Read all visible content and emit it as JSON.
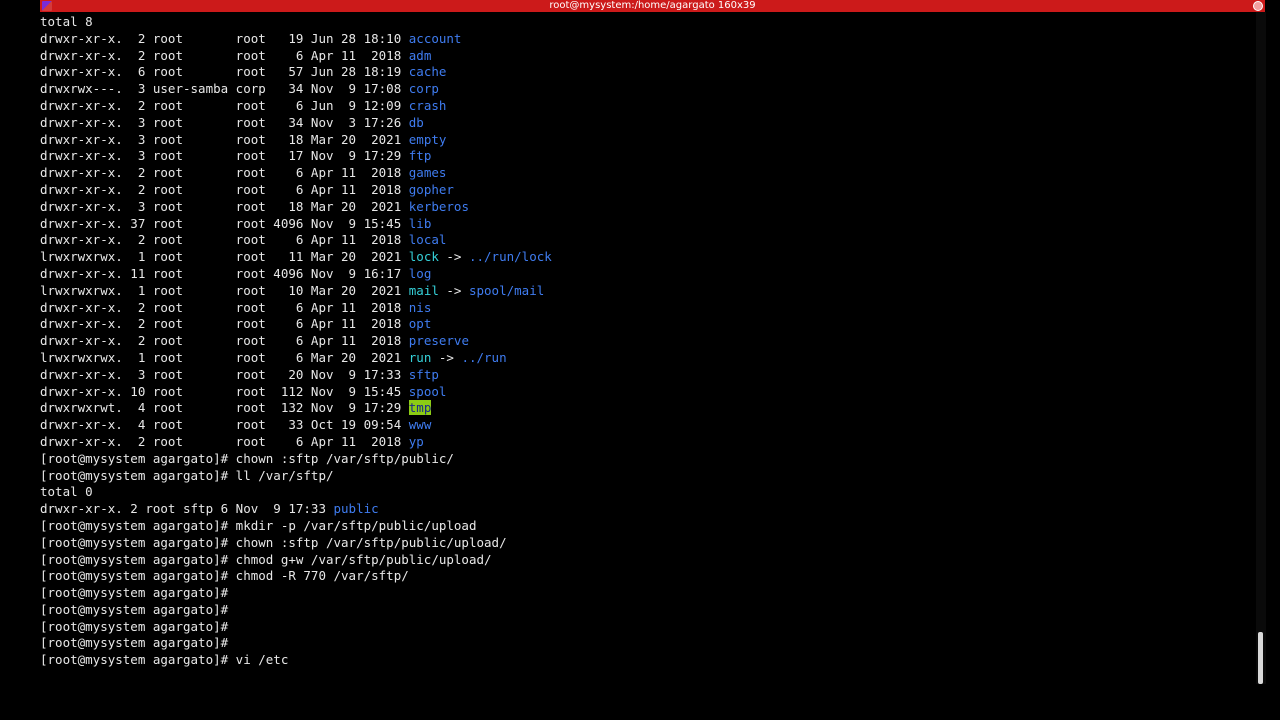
{
  "window": {
    "title": "root@mysystem:/home/agargato 160x39"
  },
  "colors": {
    "titlebar": "#cc1a1a",
    "directory": "#3f7cf0",
    "symlink": "#35d0d8",
    "sticky_highlight": "#8ccc14"
  },
  "terminal": {
    "lines": [
      [
        {
          "t": "total 8"
        }
      ],
      [
        {
          "t": "drwxr-xr-x.  2 root       root   19 Jun 28 18:10 "
        },
        {
          "t": "account",
          "c": "blue"
        }
      ],
      [
        {
          "t": "drwxr-xr-x.  2 root       root    6 Apr 11  2018 "
        },
        {
          "t": "adm",
          "c": "blue"
        }
      ],
      [
        {
          "t": "drwxr-xr-x.  6 root       root   57 Jun 28 18:19 "
        },
        {
          "t": "cache",
          "c": "blue"
        }
      ],
      [
        {
          "t": "drwxrwx---.  3 user-samba corp   34 Nov  9 17:08 "
        },
        {
          "t": "corp",
          "c": "blue"
        }
      ],
      [
        {
          "t": "drwxr-xr-x.  2 root       root    6 Jun  9 12:09 "
        },
        {
          "t": "crash",
          "c": "blue"
        }
      ],
      [
        {
          "t": "drwxr-xr-x.  3 root       root   34 Nov  3 17:26 "
        },
        {
          "t": "db",
          "c": "blue"
        }
      ],
      [
        {
          "t": "drwxr-xr-x.  3 root       root   18 Mar 20  2021 "
        },
        {
          "t": "empty",
          "c": "blue"
        }
      ],
      [
        {
          "t": "drwxr-xr-x.  3 root       root   17 Nov  9 17:29 "
        },
        {
          "t": "ftp",
          "c": "blue"
        }
      ],
      [
        {
          "t": "drwxr-xr-x.  2 root       root    6 Apr 11  2018 "
        },
        {
          "t": "games",
          "c": "blue"
        }
      ],
      [
        {
          "t": "drwxr-xr-x.  2 root       root    6 Apr 11  2018 "
        },
        {
          "t": "gopher",
          "c": "blue"
        }
      ],
      [
        {
          "t": "drwxr-xr-x.  3 root       root   18 Mar 20  2021 "
        },
        {
          "t": "kerberos",
          "c": "blue"
        }
      ],
      [
        {
          "t": "drwxr-xr-x. 37 root       root 4096 Nov  9 15:45 "
        },
        {
          "t": "lib",
          "c": "blue"
        }
      ],
      [
        {
          "t": "drwxr-xr-x.  2 root       root    6 Apr 11  2018 "
        },
        {
          "t": "local",
          "c": "blue"
        }
      ],
      [
        {
          "t": "lrwxrwxrwx.  1 root       root   11 Mar 20  2021 "
        },
        {
          "t": "lock",
          "c": "cyan"
        },
        {
          "t": " -> "
        },
        {
          "t": "../run/lock",
          "c": "blue"
        }
      ],
      [
        {
          "t": "drwxr-xr-x. 11 root       root 4096 Nov  9 16:17 "
        },
        {
          "t": "log",
          "c": "blue"
        }
      ],
      [
        {
          "t": "lrwxrwxrwx.  1 root       root   10 Mar 20  2021 "
        },
        {
          "t": "mail",
          "c": "cyan"
        },
        {
          "t": " -> "
        },
        {
          "t": "spool/mail",
          "c": "blue"
        }
      ],
      [
        {
          "t": "drwxr-xr-x.  2 root       root    6 Apr 11  2018 "
        },
        {
          "t": "nis",
          "c": "blue"
        }
      ],
      [
        {
          "t": "drwxr-xr-x.  2 root       root    6 Apr 11  2018 "
        },
        {
          "t": "opt",
          "c": "blue"
        }
      ],
      [
        {
          "t": "drwxr-xr-x.  2 root       root    6 Apr 11  2018 "
        },
        {
          "t": "preserve",
          "c": "blue"
        }
      ],
      [
        {
          "t": "lrwxrwxrwx.  1 root       root    6 Mar 20  2021 "
        },
        {
          "t": "run",
          "c": "cyan"
        },
        {
          "t": " -> "
        },
        {
          "t": "../run",
          "c": "blue"
        }
      ],
      [
        {
          "t": "drwxr-xr-x.  3 root       root   20 Nov  9 17:33 "
        },
        {
          "t": "sftp",
          "c": "blue"
        }
      ],
      [
        {
          "t": "drwxr-xr-x. 10 root       root  112 Nov  9 15:45 "
        },
        {
          "t": "spool",
          "c": "blue"
        }
      ],
      [
        {
          "t": "drwxrwxrwt.  4 root       root  132 Nov  9 17:29 "
        },
        {
          "t": "tmp",
          "c": "hl"
        }
      ],
      [
        {
          "t": "drwxr-xr-x.  4 root       root   33 Oct 19 09:54 "
        },
        {
          "t": "www",
          "c": "blue"
        }
      ],
      [
        {
          "t": "drwxr-xr-x.  2 root       root    6 Apr 11  2018 "
        },
        {
          "t": "yp",
          "c": "blue"
        }
      ],
      [
        {
          "t": "[root@mysystem agargato]# chown :sftp /var/sftp/public/"
        }
      ],
      [
        {
          "t": "[root@mysystem agargato]# ll /var/sftp/"
        }
      ],
      [
        {
          "t": "total 0"
        }
      ],
      [
        {
          "t": "drwxr-xr-x. 2 root sftp 6 Nov  9 17:33 "
        },
        {
          "t": "public",
          "c": "blue"
        }
      ],
      [
        {
          "t": "[root@mysystem agargato]# mkdir -p /var/sftp/public/upload"
        }
      ],
      [
        {
          "t": "[root@mysystem agargato]# chown :sftp /var/sftp/public/upload/"
        }
      ],
      [
        {
          "t": "[root@mysystem agargato]# chmod g+w /var/sftp/public/upload/"
        }
      ],
      [
        {
          "t": "[root@mysystem agargato]# chmod -R 770 /var/sftp/"
        }
      ],
      [
        {
          "t": "[root@mysystem agargato]#"
        }
      ],
      [
        {
          "t": "[root@mysystem agargato]#"
        }
      ],
      [
        {
          "t": "[root@mysystem agargato]#"
        }
      ],
      [
        {
          "t": "[root@mysystem agargato]#"
        }
      ],
      [
        {
          "t": "[root@mysystem agargato]# vi /etc"
        }
      ]
    ]
  }
}
